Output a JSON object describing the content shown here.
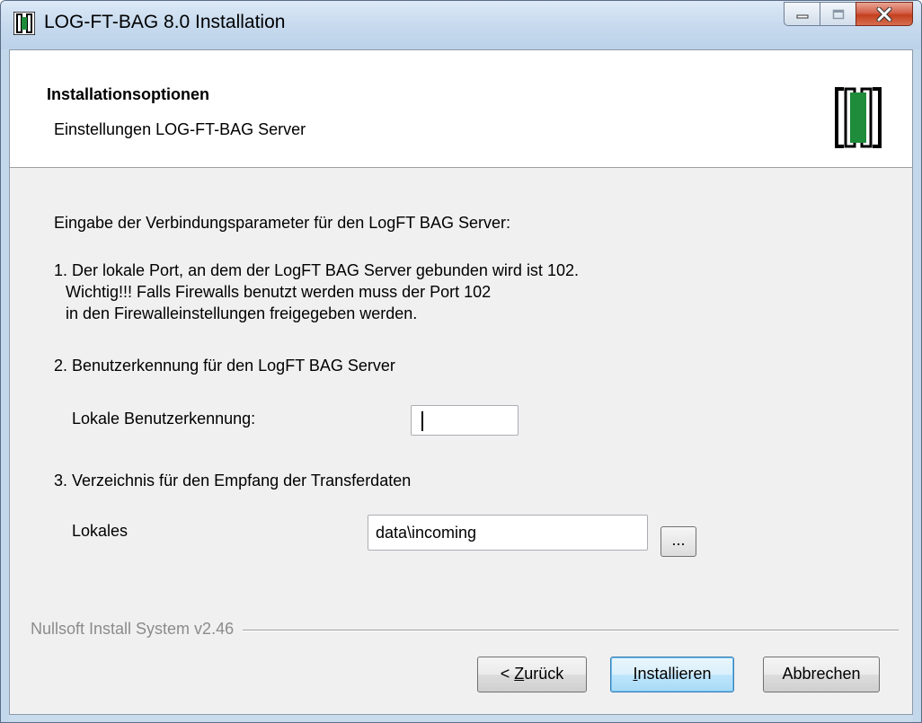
{
  "window": {
    "title": "LOG-FT-BAG 8.0 Installation",
    "buttons": [
      "minimize-icon",
      "maximize-icon",
      "close-icon"
    ]
  },
  "header": {
    "title": "Installationsoptionen",
    "subtitle": "Einstellungen LOG-FT-BAG Server"
  },
  "body": {
    "intro": "Eingabe der Verbindungsparameter für den LogFT BAG Server:",
    "step1_line1": "1. Der lokale Port, an dem der LogFT BAG Server gebunden wird ist 102.",
    "step1_line2": "Wichtig!!! Falls Firewalls benutzt werden muss der Port 102",
    "step1_line3": "in den Firewalleinstellungen freigegeben werden.",
    "step2": "2. Benutzerkennung für den LogFT BAG Server",
    "user_label": "Lokale Benutzerkennung:",
    "user_value": "",
    "step3": "3. Verzeichnis für den Empfang der Transferdaten",
    "dir_label": "Lokales",
    "dir_value": "data\\incoming",
    "browse_label": "..."
  },
  "footer": {
    "branding": "Nullsoft Install System v2.46",
    "back_prefix": "< ",
    "back_mnemonic": "Z",
    "back_rest": "urück",
    "install_mnemonic": "I",
    "install_rest": "nstallieren",
    "cancel_label": "Abbrechen"
  },
  "colors": {
    "logo_green": "#1e8c3a",
    "close_red": "#c4401f",
    "title_bar": "#c7daee"
  }
}
